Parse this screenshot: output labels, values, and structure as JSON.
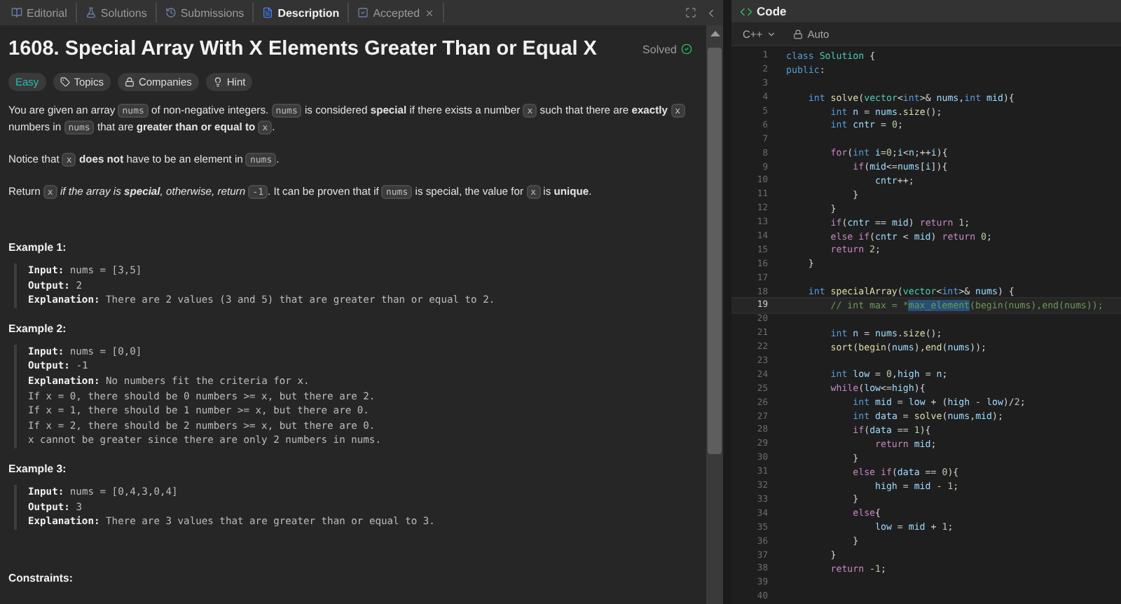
{
  "tabs": [
    {
      "label": "Editorial",
      "selected": false,
      "closable": false
    },
    {
      "label": "Solutions",
      "selected": false,
      "closable": false
    },
    {
      "label": "Submissions",
      "selected": false,
      "closable": false
    },
    {
      "label": "Description",
      "selected": true,
      "closable": false
    },
    {
      "label": "Accepted",
      "selected": false,
      "closable": true
    }
  ],
  "problem": {
    "title": "1608. Special Array With X Elements Greater Than or Equal X",
    "status": "Solved",
    "tags": [
      {
        "label": "Easy",
        "kind": "difficulty"
      },
      {
        "label": "Topics",
        "kind": "topics"
      },
      {
        "label": "Companies",
        "kind": "companies"
      },
      {
        "label": "Hint",
        "kind": "hint"
      }
    ],
    "paragraphs": [
      [
        {
          "kind": "text",
          "t": "You are given an array "
        },
        {
          "kind": "code",
          "t": "nums"
        },
        {
          "kind": "text",
          "t": " of non-negative integers. "
        },
        {
          "kind": "code",
          "t": "nums"
        },
        {
          "kind": "text",
          "t": " is considered "
        },
        {
          "kind": "bold",
          "t": "special"
        },
        {
          "kind": "text",
          "t": " if there exists a number "
        },
        {
          "kind": "code",
          "t": "x"
        },
        {
          "kind": "text",
          "t": " such that there are "
        },
        {
          "kind": "bold",
          "t": "exactly "
        },
        {
          "kind": "code",
          "t": "x"
        },
        {
          "kind": "text",
          "t": " numbers in "
        },
        {
          "kind": "code",
          "t": "nums"
        },
        {
          "kind": "text",
          "t": " that are "
        },
        {
          "kind": "bold",
          "t": "greater than or equal to "
        },
        {
          "kind": "code",
          "t": "x"
        },
        {
          "kind": "text",
          "t": "."
        }
      ],
      [
        {
          "kind": "text",
          "t": "Notice that "
        },
        {
          "kind": "code",
          "t": "x"
        },
        {
          "kind": "bold",
          "t": " does not"
        },
        {
          "kind": "text",
          "t": " have to be an element in "
        },
        {
          "kind": "code",
          "t": "nums"
        },
        {
          "kind": "text",
          "t": "."
        }
      ],
      [
        {
          "kind": "text",
          "t": "Return "
        },
        {
          "kind": "code",
          "t": "x"
        },
        {
          "kind": "italic",
          "t": " if the array is "
        },
        {
          "kind": "bolditalic",
          "t": "special"
        },
        {
          "kind": "italic",
          "t": ", otherwise, return "
        },
        {
          "kind": "code",
          "t": "-1"
        },
        {
          "kind": "text",
          "t": ". It can be proven that if "
        },
        {
          "kind": "code",
          "t": "nums"
        },
        {
          "kind": "text",
          "t": " is special, the value for "
        },
        {
          "kind": "code",
          "t": "x"
        },
        {
          "kind": "text",
          "t": " is "
        },
        {
          "kind": "bold",
          "t": "unique"
        },
        {
          "kind": "text",
          "t": "."
        }
      ]
    ],
    "examples": [
      {
        "heading": "Example 1:",
        "rows": [
          {
            "label": "Input:",
            "value": "nums = [3,5]"
          },
          {
            "label": "Output:",
            "value": "2"
          },
          {
            "label": "Explanation:",
            "value": "There are 2 values (3 and 5) that are greater than or equal to 2."
          }
        ]
      },
      {
        "heading": "Example 2:",
        "rows": [
          {
            "label": "Input:",
            "value": "nums = [0,0]"
          },
          {
            "label": "Output:",
            "value": "-1"
          },
          {
            "label": "Explanation:",
            "value": "No numbers fit the criteria for x."
          },
          {
            "value": "If x = 0, there should be 0 numbers >= x, but there are 2."
          },
          {
            "value": "If x = 1, there should be 1 number >= x, but there are 0."
          },
          {
            "value": "If x = 2, there should be 2 numbers >= x, but there are 0."
          },
          {
            "value": "x cannot be greater since there are only 2 numbers in nums."
          }
        ]
      },
      {
        "heading": "Example 3:",
        "rows": [
          {
            "label": "Input:",
            "value": "nums = [0,4,3,0,4]"
          },
          {
            "label": "Output:",
            "value": "3"
          },
          {
            "label": "Explanation:",
            "value": "There are 3 values that are greater than or equal to 3."
          }
        ]
      }
    ],
    "constraints_heading": "Constraints:"
  },
  "editor": {
    "title": "Code",
    "language": "C++",
    "mode": "Auto",
    "lines": [
      {
        "n": "1",
        "active": false,
        "tokens": [
          {
            "kind": "kw",
            "t": "class "
          },
          {
            "kind": "type",
            "t": "Solution"
          },
          {
            "kind": "p",
            "t": " {"
          }
        ]
      },
      {
        "n": "2",
        "active": false,
        "tokens": [
          {
            "kind": "kw",
            "t": "public"
          },
          {
            "kind": "p",
            "t": ":"
          }
        ]
      },
      {
        "n": "3",
        "active": false
      },
      {
        "n": "4",
        "active": false,
        "tokens": [
          {
            "kind": "kw",
            "t": "    int "
          },
          {
            "kind": "fn",
            "t": "solve"
          },
          {
            "kind": "p",
            "t": "("
          },
          {
            "kind": "type",
            "t": "vector"
          },
          {
            "kind": "p",
            "t": "<"
          },
          {
            "kind": "kw",
            "t": "int"
          },
          {
            "kind": "p",
            "t": ">& "
          },
          {
            "kind": "var",
            "t": "nums"
          },
          {
            "kind": "p",
            "t": ","
          },
          {
            "kind": "kw",
            "t": "int "
          },
          {
            "kind": "var",
            "t": "mid"
          },
          {
            "kind": "p",
            "t": "){"
          }
        ]
      },
      {
        "n": "5",
        "active": false,
        "tokens": [
          {
            "kind": "kw",
            "t": "        int "
          },
          {
            "kind": "var",
            "t": "n"
          },
          {
            "kind": "p",
            "t": " = "
          },
          {
            "kind": "var",
            "t": "nums"
          },
          {
            "kind": "p",
            "t": "."
          },
          {
            "kind": "fn",
            "t": "size"
          },
          {
            "kind": "p",
            "t": "();"
          }
        ]
      },
      {
        "n": "6",
        "active": false,
        "tokens": [
          {
            "kind": "kw",
            "t": "        int "
          },
          {
            "kind": "var",
            "t": "cntr"
          },
          {
            "kind": "p",
            "t": " = "
          },
          {
            "kind": "num",
            "t": "0"
          },
          {
            "kind": "p",
            "t": ";"
          }
        ]
      },
      {
        "n": "7",
        "active": false
      },
      {
        "n": "8",
        "active": false,
        "tokens": [
          {
            "kind": "ctl",
            "t": "        for"
          },
          {
            "kind": "p",
            "t": "("
          },
          {
            "kind": "kw",
            "t": "int "
          },
          {
            "kind": "var",
            "t": "i"
          },
          {
            "kind": "p",
            "t": "="
          },
          {
            "kind": "num",
            "t": "0"
          },
          {
            "kind": "p",
            "t": ";"
          },
          {
            "kind": "var",
            "t": "i"
          },
          {
            "kind": "p",
            "t": "<"
          },
          {
            "kind": "var",
            "t": "n"
          },
          {
            "kind": "p",
            "t": ";++"
          },
          {
            "kind": "var",
            "t": "i"
          },
          {
            "kind": "p",
            "t": "){"
          }
        ]
      },
      {
        "n": "9",
        "active": false,
        "tokens": [
          {
            "kind": "ctl",
            "t": "            if"
          },
          {
            "kind": "p",
            "t": "("
          },
          {
            "kind": "var",
            "t": "mid"
          },
          {
            "kind": "p",
            "t": "<="
          },
          {
            "kind": "var",
            "t": "nums"
          },
          {
            "kind": "p",
            "t": "["
          },
          {
            "kind": "var",
            "t": "i"
          },
          {
            "kind": "p",
            "t": "]){"
          }
        ]
      },
      {
        "n": "10",
        "active": false,
        "tokens": [
          {
            "kind": "var",
            "t": "                cntr"
          },
          {
            "kind": "p",
            "t": "++;"
          }
        ]
      },
      {
        "n": "11",
        "active": false,
        "tokens": [
          {
            "kind": "p",
            "t": "            }"
          }
        ]
      },
      {
        "n": "12",
        "active": false,
        "tokens": [
          {
            "kind": "p",
            "t": "        }"
          }
        ]
      },
      {
        "n": "13",
        "active": false,
        "tokens": [
          {
            "kind": "ctl",
            "t": "        if"
          },
          {
            "kind": "p",
            "t": "("
          },
          {
            "kind": "var",
            "t": "cntr"
          },
          {
            "kind": "p",
            "t": " == "
          },
          {
            "kind": "var",
            "t": "mid"
          },
          {
            "kind": "p",
            "t": ") "
          },
          {
            "kind": "ctl",
            "t": "return "
          },
          {
            "kind": "num",
            "t": "1"
          },
          {
            "kind": "p",
            "t": ";"
          }
        ]
      },
      {
        "n": "14",
        "active": false,
        "tokens": [
          {
            "kind": "ctl",
            "t": "        else if"
          },
          {
            "kind": "p",
            "t": "("
          },
          {
            "kind": "var",
            "t": "cntr"
          },
          {
            "kind": "p",
            "t": " < "
          },
          {
            "kind": "var",
            "t": "mid"
          },
          {
            "kind": "p",
            "t": ") "
          },
          {
            "kind": "ctl",
            "t": "return "
          },
          {
            "kind": "num",
            "t": "0"
          },
          {
            "kind": "p",
            "t": ";"
          }
        ]
      },
      {
        "n": "15",
        "active": false,
        "tokens": [
          {
            "kind": "ctl",
            "t": "        return "
          },
          {
            "kind": "num",
            "t": "2"
          },
          {
            "kind": "p",
            "t": ";"
          }
        ]
      },
      {
        "n": "16",
        "active": false,
        "tokens": [
          {
            "kind": "p",
            "t": "    }"
          }
        ]
      },
      {
        "n": "17",
        "active": false
      },
      {
        "n": "18",
        "active": false,
        "tokens": [
          {
            "kind": "kw",
            "t": "    int "
          },
          {
            "kind": "fn",
            "t": "specialArray"
          },
          {
            "kind": "p",
            "t": "("
          },
          {
            "kind": "type",
            "t": "vector"
          },
          {
            "kind": "p",
            "t": "<"
          },
          {
            "kind": "kw",
            "t": "int"
          },
          {
            "kind": "p",
            "t": ">& "
          },
          {
            "kind": "var",
            "t": "nums"
          },
          {
            "kind": "p",
            "t": ") {"
          }
        ]
      },
      {
        "n": "19",
        "active": true,
        "tokens": [
          {
            "kind": "com",
            "t": "        // int max = *"
          },
          {
            "kind": "sel",
            "t": "max_element"
          },
          {
            "kind": "com",
            "t": "(begin(nums),end(nums));"
          }
        ]
      },
      {
        "n": "20",
        "active": false
      },
      {
        "n": "21",
        "active": false,
        "tokens": [
          {
            "kind": "kw",
            "t": "        int "
          },
          {
            "kind": "var",
            "t": "n"
          },
          {
            "kind": "p",
            "t": " = "
          },
          {
            "kind": "var",
            "t": "nums"
          },
          {
            "kind": "p",
            "t": "."
          },
          {
            "kind": "fn",
            "t": "size"
          },
          {
            "kind": "p",
            "t": "();"
          }
        ]
      },
      {
        "n": "22",
        "active": false,
        "tokens": [
          {
            "kind": "fn",
            "t": "        sort"
          },
          {
            "kind": "p",
            "t": "("
          },
          {
            "kind": "fn",
            "t": "begin"
          },
          {
            "kind": "p",
            "t": "("
          },
          {
            "kind": "var",
            "t": "nums"
          },
          {
            "kind": "p",
            "t": "),"
          },
          {
            "kind": "fn",
            "t": "end"
          },
          {
            "kind": "p",
            "t": "("
          },
          {
            "kind": "var",
            "t": "nums"
          },
          {
            "kind": "p",
            "t": "));"
          }
        ]
      },
      {
        "n": "23",
        "active": false
      },
      {
        "n": "24",
        "active": false,
        "tokens": [
          {
            "kind": "kw",
            "t": "        int "
          },
          {
            "kind": "var",
            "t": "low"
          },
          {
            "kind": "p",
            "t": " = "
          },
          {
            "kind": "num",
            "t": "0"
          },
          {
            "kind": "p",
            "t": ","
          },
          {
            "kind": "var",
            "t": "high"
          },
          {
            "kind": "p",
            "t": " = "
          },
          {
            "kind": "var",
            "t": "n"
          },
          {
            "kind": "p",
            "t": ";"
          }
        ]
      },
      {
        "n": "25",
        "active": false,
        "tokens": [
          {
            "kind": "ctl",
            "t": "        while"
          },
          {
            "kind": "p",
            "t": "("
          },
          {
            "kind": "var",
            "t": "low"
          },
          {
            "kind": "p",
            "t": "<="
          },
          {
            "kind": "var",
            "t": "high"
          },
          {
            "kind": "p",
            "t": "){"
          }
        ]
      },
      {
        "n": "26",
        "active": false,
        "tokens": [
          {
            "kind": "kw",
            "t": "            int "
          },
          {
            "kind": "var",
            "t": "mid"
          },
          {
            "kind": "p",
            "t": " = "
          },
          {
            "kind": "var",
            "t": "low"
          },
          {
            "kind": "p",
            "t": " + ("
          },
          {
            "kind": "var",
            "t": "high"
          },
          {
            "kind": "p",
            "t": " - "
          },
          {
            "kind": "var",
            "t": "low"
          },
          {
            "kind": "p",
            "t": ")/"
          },
          {
            "kind": "num",
            "t": "2"
          },
          {
            "kind": "p",
            "t": ";"
          }
        ]
      },
      {
        "n": "27",
        "active": false,
        "tokens": [
          {
            "kind": "kw",
            "t": "            int "
          },
          {
            "kind": "var",
            "t": "data"
          },
          {
            "kind": "p",
            "t": " = "
          },
          {
            "kind": "fn",
            "t": "solve"
          },
          {
            "kind": "p",
            "t": "("
          },
          {
            "kind": "var",
            "t": "nums"
          },
          {
            "kind": "p",
            "t": ","
          },
          {
            "kind": "var",
            "t": "mid"
          },
          {
            "kind": "p",
            "t": ");"
          }
        ]
      },
      {
        "n": "28",
        "active": false,
        "tokens": [
          {
            "kind": "ctl",
            "t": "            if"
          },
          {
            "kind": "p",
            "t": "("
          },
          {
            "kind": "var",
            "t": "data"
          },
          {
            "kind": "p",
            "t": " == "
          },
          {
            "kind": "num",
            "t": "1"
          },
          {
            "kind": "p",
            "t": "){"
          }
        ]
      },
      {
        "n": "29",
        "active": false,
        "tokens": [
          {
            "kind": "ctl",
            "t": "                return "
          },
          {
            "kind": "var",
            "t": "mid"
          },
          {
            "kind": "p",
            "t": ";"
          }
        ]
      },
      {
        "n": "30",
        "active": false,
        "tokens": [
          {
            "kind": "p",
            "t": "            }"
          }
        ]
      },
      {
        "n": "31",
        "active": false,
        "tokens": [
          {
            "kind": "ctl",
            "t": "            else if"
          },
          {
            "kind": "p",
            "t": "("
          },
          {
            "kind": "var",
            "t": "data"
          },
          {
            "kind": "p",
            "t": " == "
          },
          {
            "kind": "num",
            "t": "0"
          },
          {
            "kind": "p",
            "t": "){"
          }
        ]
      },
      {
        "n": "32",
        "active": false,
        "tokens": [
          {
            "kind": "var",
            "t": "                high"
          },
          {
            "kind": "p",
            "t": " = "
          },
          {
            "kind": "var",
            "t": "mid"
          },
          {
            "kind": "p",
            "t": " - "
          },
          {
            "kind": "num",
            "t": "1"
          },
          {
            "kind": "p",
            "t": ";"
          }
        ]
      },
      {
        "n": "33",
        "active": false,
        "tokens": [
          {
            "kind": "p",
            "t": "            }"
          }
        ]
      },
      {
        "n": "34",
        "active": false,
        "tokens": [
          {
            "kind": "ctl",
            "t": "            else"
          },
          {
            "kind": "p",
            "t": "{"
          }
        ]
      },
      {
        "n": "35",
        "active": false,
        "tokens": [
          {
            "kind": "var",
            "t": "                low"
          },
          {
            "kind": "p",
            "t": " = "
          },
          {
            "kind": "var",
            "t": "mid"
          },
          {
            "kind": "p",
            "t": " + "
          },
          {
            "kind": "num",
            "t": "1"
          },
          {
            "kind": "p",
            "t": ";"
          }
        ]
      },
      {
        "n": "36",
        "active": false,
        "tokens": [
          {
            "kind": "p",
            "t": "            }"
          }
        ]
      },
      {
        "n": "37",
        "active": false,
        "tokens": [
          {
            "kind": "p",
            "t": "        }"
          }
        ]
      },
      {
        "n": "38",
        "active": false,
        "tokens": [
          {
            "kind": "ctl",
            "t": "        return "
          },
          {
            "kind": "p",
            "t": "-"
          },
          {
            "kind": "num",
            "t": "1"
          },
          {
            "kind": "p",
            "t": ";"
          }
        ]
      },
      {
        "n": "39",
        "active": false
      },
      {
        "n": "40",
        "active": false
      }
    ]
  }
}
